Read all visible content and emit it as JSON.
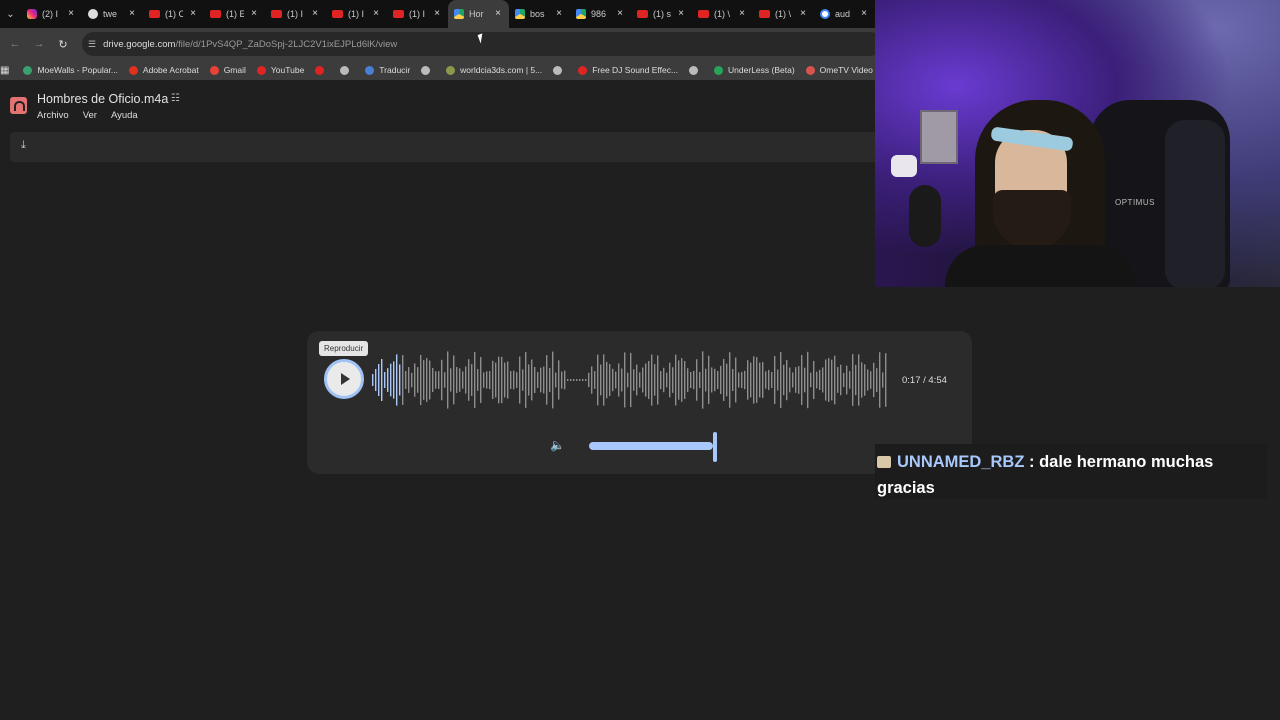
{
  "tabs": [
    {
      "title": "(2) I",
      "favicon": "instagram-icon",
      "active": false
    },
    {
      "title": "twe",
      "favicon": "threads-icon",
      "active": false
    },
    {
      "title": "(1) C",
      "favicon": "youtube-icon",
      "active": false
    },
    {
      "title": "(1) E",
      "favicon": "youtube-icon",
      "active": false
    },
    {
      "title": "(1) I",
      "favicon": "youtube-icon",
      "active": false
    },
    {
      "title": "(1) I",
      "favicon": "youtube-icon",
      "active": false
    },
    {
      "title": "(1) I",
      "favicon": "youtube-icon",
      "active": false
    },
    {
      "title": "Hor",
      "favicon": "drive-icon",
      "active": true
    },
    {
      "title": "bos",
      "favicon": "drive-icon",
      "active": false
    },
    {
      "title": "986",
      "favicon": "drive-icon",
      "active": false
    },
    {
      "title": "(1) s",
      "favicon": "youtube-icon",
      "active": false
    },
    {
      "title": "(1) \\",
      "favicon": "youtube-icon",
      "active": false
    },
    {
      "title": "(1) \\",
      "favicon": "youtube-icon",
      "active": false
    },
    {
      "title": "aud",
      "favicon": "google-icon",
      "active": false
    }
  ],
  "toolbar": {
    "url_host": "drive.google.com",
    "url_path": "/file/d/1PvS4QP_ZaDoSpj-2LJC2V1ixEJPLd6lK/view"
  },
  "bookmarks": [
    {
      "label": "MoeWalls - Popular...",
      "color": "#3aa06d"
    },
    {
      "label": "Adobe Acrobat",
      "color": "#e0301e"
    },
    {
      "label": "Gmail",
      "color": "#ea4335"
    },
    {
      "label": "YouTube",
      "color": "#e02424"
    },
    {
      "label": "",
      "color": "#e02424"
    },
    {
      "label": "",
      "color": "#bbbbbb"
    },
    {
      "label": "Traducir",
      "color": "#4a7fd6"
    },
    {
      "label": "",
      "color": "#bbbbbb"
    },
    {
      "label": "worldcia3ds.com | 5...",
      "color": "#8a9a4a"
    },
    {
      "label": "",
      "color": "#bbbbbb"
    },
    {
      "label": "Free DJ Sound Effec...",
      "color": "#e02424"
    },
    {
      "label": "",
      "color": "#bbbbbb"
    },
    {
      "label": "UnderLess (Beta)",
      "color": "#27a35a"
    },
    {
      "label": "OmeTV Video Chat...",
      "color": "#d9534f"
    }
  ],
  "drive": {
    "file_title": "Hombres de Oficio.m4a",
    "menu": [
      "Archivo",
      "Ver",
      "Ayuda"
    ]
  },
  "player": {
    "tooltip": "Reproducir",
    "time": "0:17 / 4:54",
    "progress": 0.058,
    "volume": 1.0,
    "accent": "#a8c7fa"
  },
  "chat": {
    "user": "UNNAMED_RBZ",
    "separator": " : ",
    "message": "dale hermano muchas gracias"
  },
  "webcam": {
    "chair_text": "OPTIMUS"
  }
}
